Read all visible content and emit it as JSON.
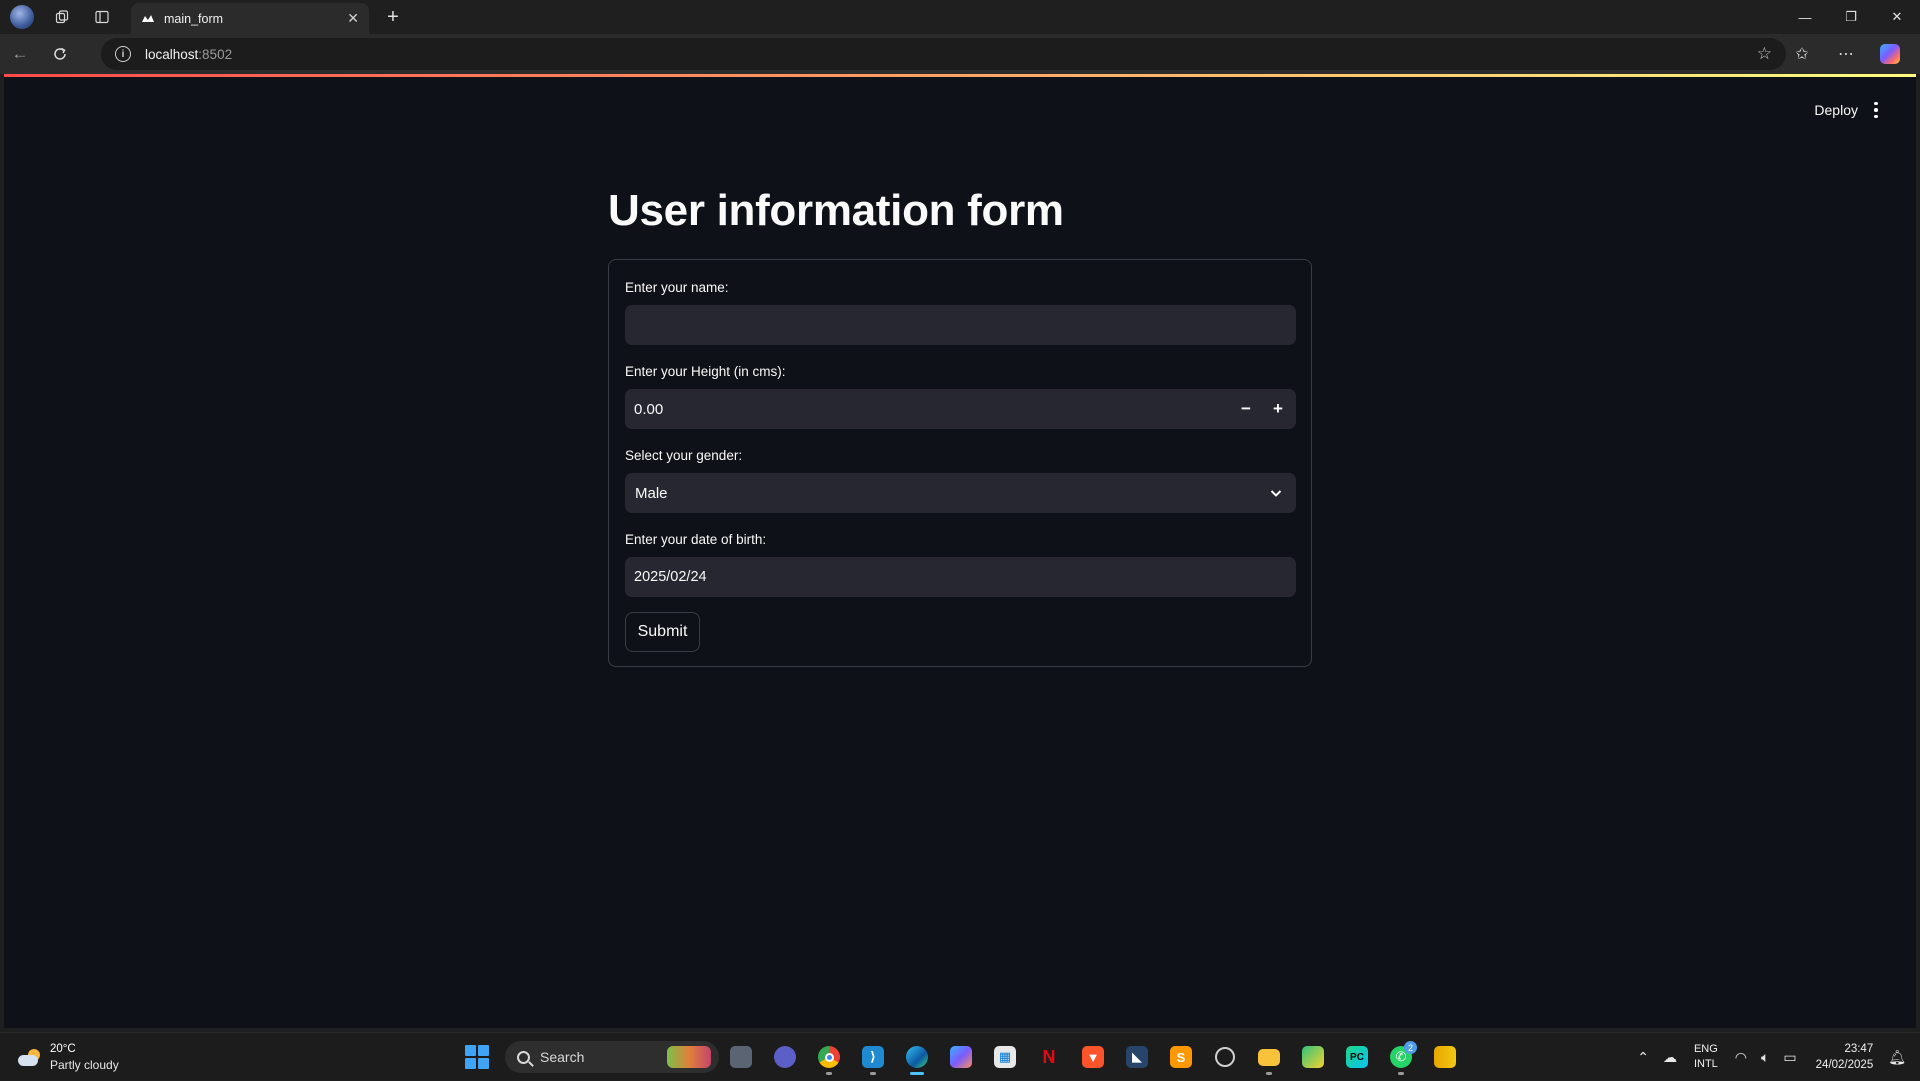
{
  "browser": {
    "tab_title": "main_form",
    "url_host": "localhost",
    "url_port": ":8502"
  },
  "app": {
    "deploy_label": "Deploy",
    "title": "User information form",
    "accent_gradient": [
      "#ff4b4b",
      "#fffd80"
    ],
    "form": {
      "name_label": "Enter your name:",
      "name_value": "",
      "height_label": "Enter your Height (in cms):",
      "height_value": "0.00",
      "minus": "−",
      "plus": "+",
      "gender_label": "Select your gender:",
      "gender_value": "Male",
      "dob_label": "Enter your date of birth:",
      "dob_value": "2025/02/24",
      "submit_label": "Submit"
    }
  },
  "taskbar": {
    "weather_temp": "20°C",
    "weather_condition": "Partly cloudy",
    "search_label": "Search",
    "whatsapp_badge": "2",
    "lang_line1": "ENG",
    "lang_line2": "INTL",
    "time": "23:47",
    "date": "24/02/2025",
    "apps": [
      "task-view",
      "teams-meet",
      "chrome",
      "vscode",
      "edge",
      "copilot",
      "store",
      "netflix",
      "brave",
      "app-blue",
      "sublime",
      "obs",
      "file-explorer",
      "snipping",
      "pycharm",
      "whatsapp",
      "power-bi"
    ]
  }
}
